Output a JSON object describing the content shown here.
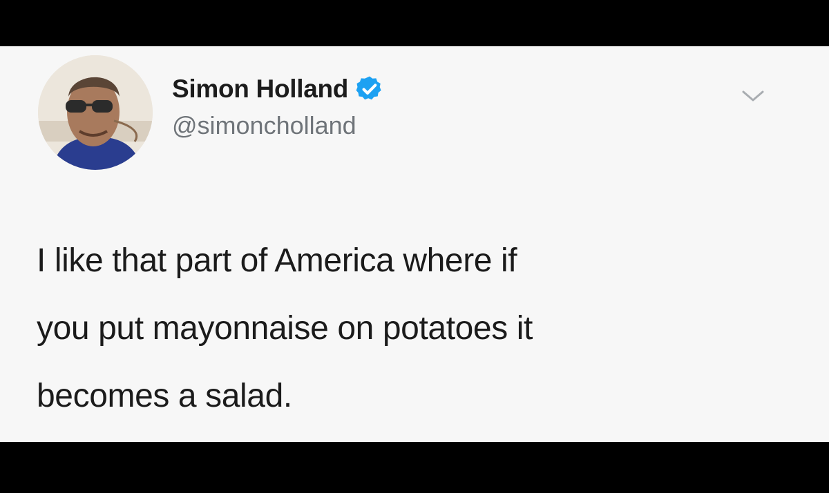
{
  "tweet": {
    "author": {
      "display_name": "Simon Holland",
      "handle": "@simoncholland",
      "verified": true,
      "avatar_icon": "user-avatar"
    },
    "menu_icon": "chevron-down-icon",
    "text_lines": [
      "I like that part of America where if",
      "you put mayonnaise on potatoes it",
      "becomes a salad."
    ]
  },
  "colors": {
    "background": "#000000",
    "card": "#f7f7f7",
    "text": "#1b1b1b",
    "handle": "#6f7479",
    "verified_badge": "#1da1f2"
  }
}
